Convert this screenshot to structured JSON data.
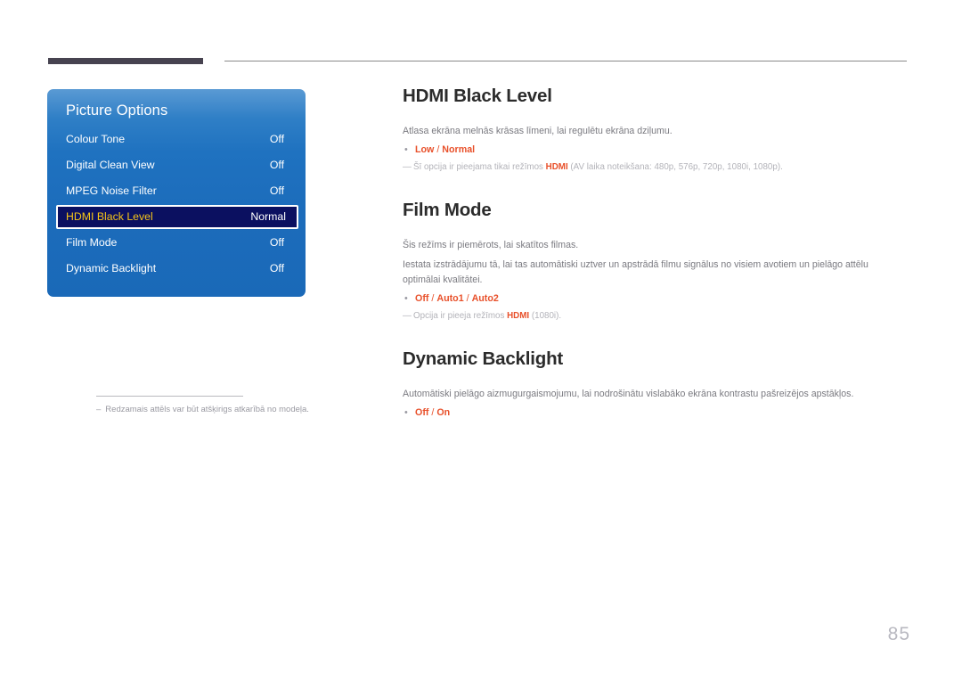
{
  "page": {
    "number": "85"
  },
  "osd": {
    "title": "Picture Options",
    "rows": [
      {
        "label": "Colour Tone",
        "value": "Off"
      },
      {
        "label": "Digital Clean View",
        "value": "Off"
      },
      {
        "label": "MPEG Noise Filter",
        "value": "Off"
      },
      {
        "label": "HDMI Black Level",
        "value": "Normal"
      },
      {
        "label": "Film Mode",
        "value": "Off"
      },
      {
        "label": "Dynamic Backlight",
        "value": "Off"
      }
    ],
    "selected_index": 3,
    "footnote": {
      "dash": "–",
      "text": "Redzamais attēls var būt atšķirigs atkarībā no modeļa."
    }
  },
  "sections": [
    {
      "title": "HDMI Black Level",
      "paragraphs": [
        "Atlasa ekrāna melnās krāsas līmeni, lai regulētu ekrāna dziļumu."
      ],
      "bullet": {
        "dot": "•",
        "options": [
          "Low",
          "Normal"
        ],
        "separator": " / "
      },
      "note": {
        "emdash": "—",
        "before": "Šī opcija ir pieejama tikai režīmos ",
        "highlight": "HDMI",
        "after": " (AV laika noteikšana: 480p, 576p, 720p, 1080i, 1080p)."
      }
    },
    {
      "title": "Film Mode",
      "paragraphs": [
        "Šis režīms ir piemērots, lai skatītos filmas.",
        "Iestata izstrādājumu tā, lai tas automātiski uztver un apstrādā filmu signālus no visiem avotiem un pielāgo attēlu optimālai kvalitātei."
      ],
      "bullet": {
        "dot": "•",
        "options": [
          "Off",
          "Auto1",
          "Auto2"
        ],
        "separator": " / "
      },
      "note": {
        "emdash": "—",
        "before": "Opcija ir pieeja režīmos ",
        "highlight": "HDMI",
        "after": " (1080i)."
      }
    },
    {
      "title": "Dynamic Backlight",
      "paragraphs": [
        "Automātiski pielāgo aizmugurgaismojumu, lai nodrošinātu vislabāko ekrāna kontrastu pašreizējos apstākļos."
      ],
      "bullet": {
        "dot": "•",
        "options": [
          "Off",
          "On"
        ],
        "separator": " / "
      },
      "note": null
    }
  ],
  "colors": {
    "accent_orange": "#e8502a",
    "osd_blue": "#1f72c0",
    "osd_selected_bg": "#0b1060",
    "osd_selected_label": "#f5c518",
    "header_bar": "#474350",
    "muted_text": "#7a7a80"
  }
}
